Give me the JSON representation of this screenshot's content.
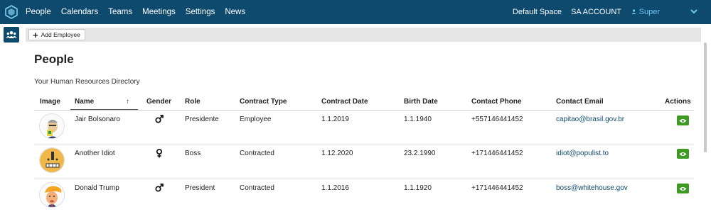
{
  "topbar": {
    "nav": [
      "People",
      "Calendars",
      "Teams",
      "Meetings",
      "Settings",
      "News"
    ],
    "space": "Default Space",
    "account": "SA ACCOUNT",
    "user": "Super"
  },
  "toolbar": {
    "add_label": "Add Employee"
  },
  "page": {
    "title": "People",
    "subtitle": "Your Human Resources Directory"
  },
  "table": {
    "headers": [
      "Image",
      "Name",
      "Gender",
      "Role",
      "Contract Type",
      "Contract Date",
      "Birth Date",
      "Contact Phone",
      "Contact Email",
      "Actions"
    ],
    "sort_arrow": "↑",
    "rows": [
      {
        "name": "Jair Bolsonaro",
        "gender": "male",
        "role": "Presidente",
        "contract_type": "Employee",
        "contract_date": "1.1.2019",
        "birth_date": "1.1.1940",
        "phone": "+557146441452",
        "email": "capitao@brasil.gov.br"
      },
      {
        "name": "Another Idiot",
        "gender": "female",
        "role": "Boss",
        "contract_type": "Contracted",
        "contract_date": "1.12.2020",
        "birth_date": "23.2.1990",
        "phone": "+171446441452",
        "email": "idiot@populist.to"
      },
      {
        "name": "Donald Trump",
        "gender": "male",
        "role": "President",
        "contract_type": "Contracted",
        "contract_date": "1.1.2016",
        "birth_date": "1.1.1920",
        "phone": "+171446441452",
        "email": "boss@whitehouse.gov"
      }
    ]
  },
  "colors": {
    "topbar": "#0e4a6e",
    "user_link": "#6ec6f0",
    "email_link": "#0e4a6e",
    "action_button": "#3f9a24"
  },
  "icons": [
    "app-logo-icon",
    "chevron-down-icon",
    "user-icon",
    "people-icon",
    "plus-icon",
    "male-icon",
    "female-icon",
    "eye-icon"
  ]
}
